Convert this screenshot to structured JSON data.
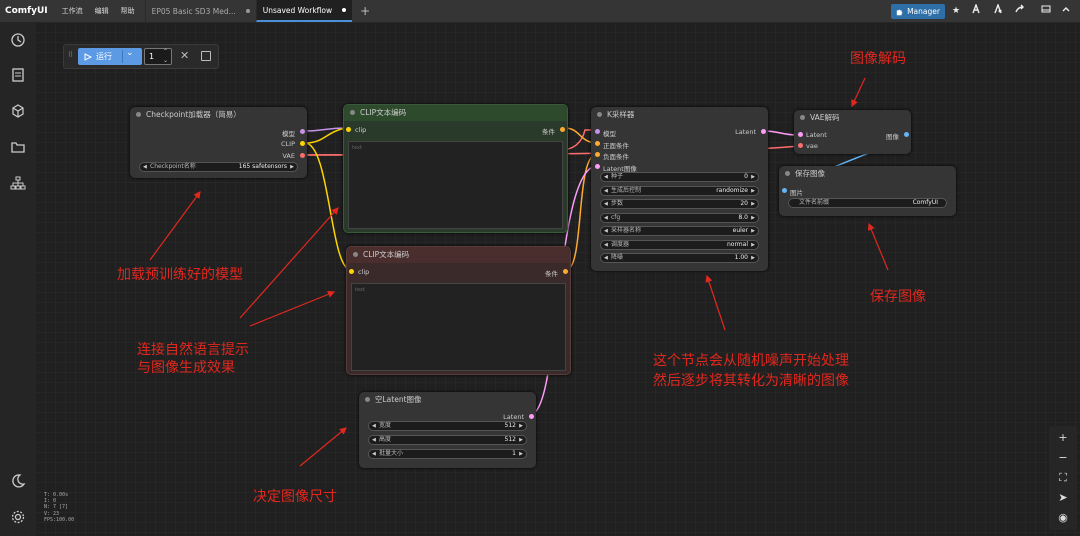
{
  "topbar": {
    "logo": "ComfyUI",
    "menu": [
      "工作流",
      "编辑",
      "帮助"
    ],
    "tabs": [
      {
        "label": "EP05 Basic SD3 Med...",
        "active": false
      },
      {
        "label": "Unsaved Workflow",
        "active": true
      }
    ],
    "add_tab": "+",
    "manager_label": "Manager"
  },
  "runbar": {
    "run_label": "运行",
    "count": "1"
  },
  "nodes": {
    "checkpoint": {
      "title": "Checkpoint加载器（简易）",
      "outputs": [
        "模型",
        "CLIP",
        "VAE"
      ],
      "widget_label": "Checkpoint名称",
      "widget_value": "165 safetensors"
    },
    "clip_pos": {
      "title": "CLIP文本编码",
      "input": "clip",
      "output": "条件",
      "placeholder": "text"
    },
    "clip_neg": {
      "title": "CLIP文本编码",
      "input": "clip",
      "output": "条件",
      "placeholder": "text"
    },
    "ksampler": {
      "title": "K采样器",
      "inputs": [
        "模型",
        "正面条件",
        "负面条件",
        "Latent图像"
      ],
      "output": "Latent",
      "widgets": [
        {
          "label": "种子",
          "value": "0"
        },
        {
          "label": "生成后控制",
          "value": "randomize"
        },
        {
          "label": "步数",
          "value": "20"
        },
        {
          "label": "cfg",
          "value": "8.0"
        },
        {
          "label": "采样器名称",
          "value": "euler"
        },
        {
          "label": "调度器",
          "value": "normal"
        },
        {
          "label": "降噪",
          "value": "1.00"
        }
      ]
    },
    "vae": {
      "title": "VAE解码",
      "inputs": [
        "Latent",
        "vae"
      ],
      "output": "图像"
    },
    "save": {
      "title": "保存图像",
      "input": "图片",
      "widget_label": "文件名前缀",
      "widget_value": "ComfyUI"
    },
    "latent": {
      "title": "空Latent图像",
      "output": "Latent",
      "widgets": [
        {
          "label": "宽度",
          "value": "512"
        },
        {
          "label": "高度",
          "value": "512"
        },
        {
          "label": "批量大小",
          "value": "1"
        }
      ]
    }
  },
  "annotations": {
    "load_model": "加载预训练好的模型",
    "clip_1": "连接自然语言提示",
    "clip_2": "与图像生成效果",
    "ksampler_1": "这个节点会从随机噪声开始处理",
    "ksampler_2": "然后逐步将其转化为清晰的图像",
    "vae_decode": "图像解码",
    "save_image": "保存图像",
    "image_size": "决定图像尺寸"
  },
  "stats": [
    "T: 0.00s",
    "I: 0",
    "N: 7 [7]",
    "V: 23",
    "FPS:100.00"
  ],
  "colors": {
    "clip_pos_node": "#2d4a2d",
    "clip_neg_node": "#4a2d2d",
    "annotation": "#e0281e",
    "manager_button": "#2e6fa8",
    "run_button": "#5c9ae6"
  }
}
